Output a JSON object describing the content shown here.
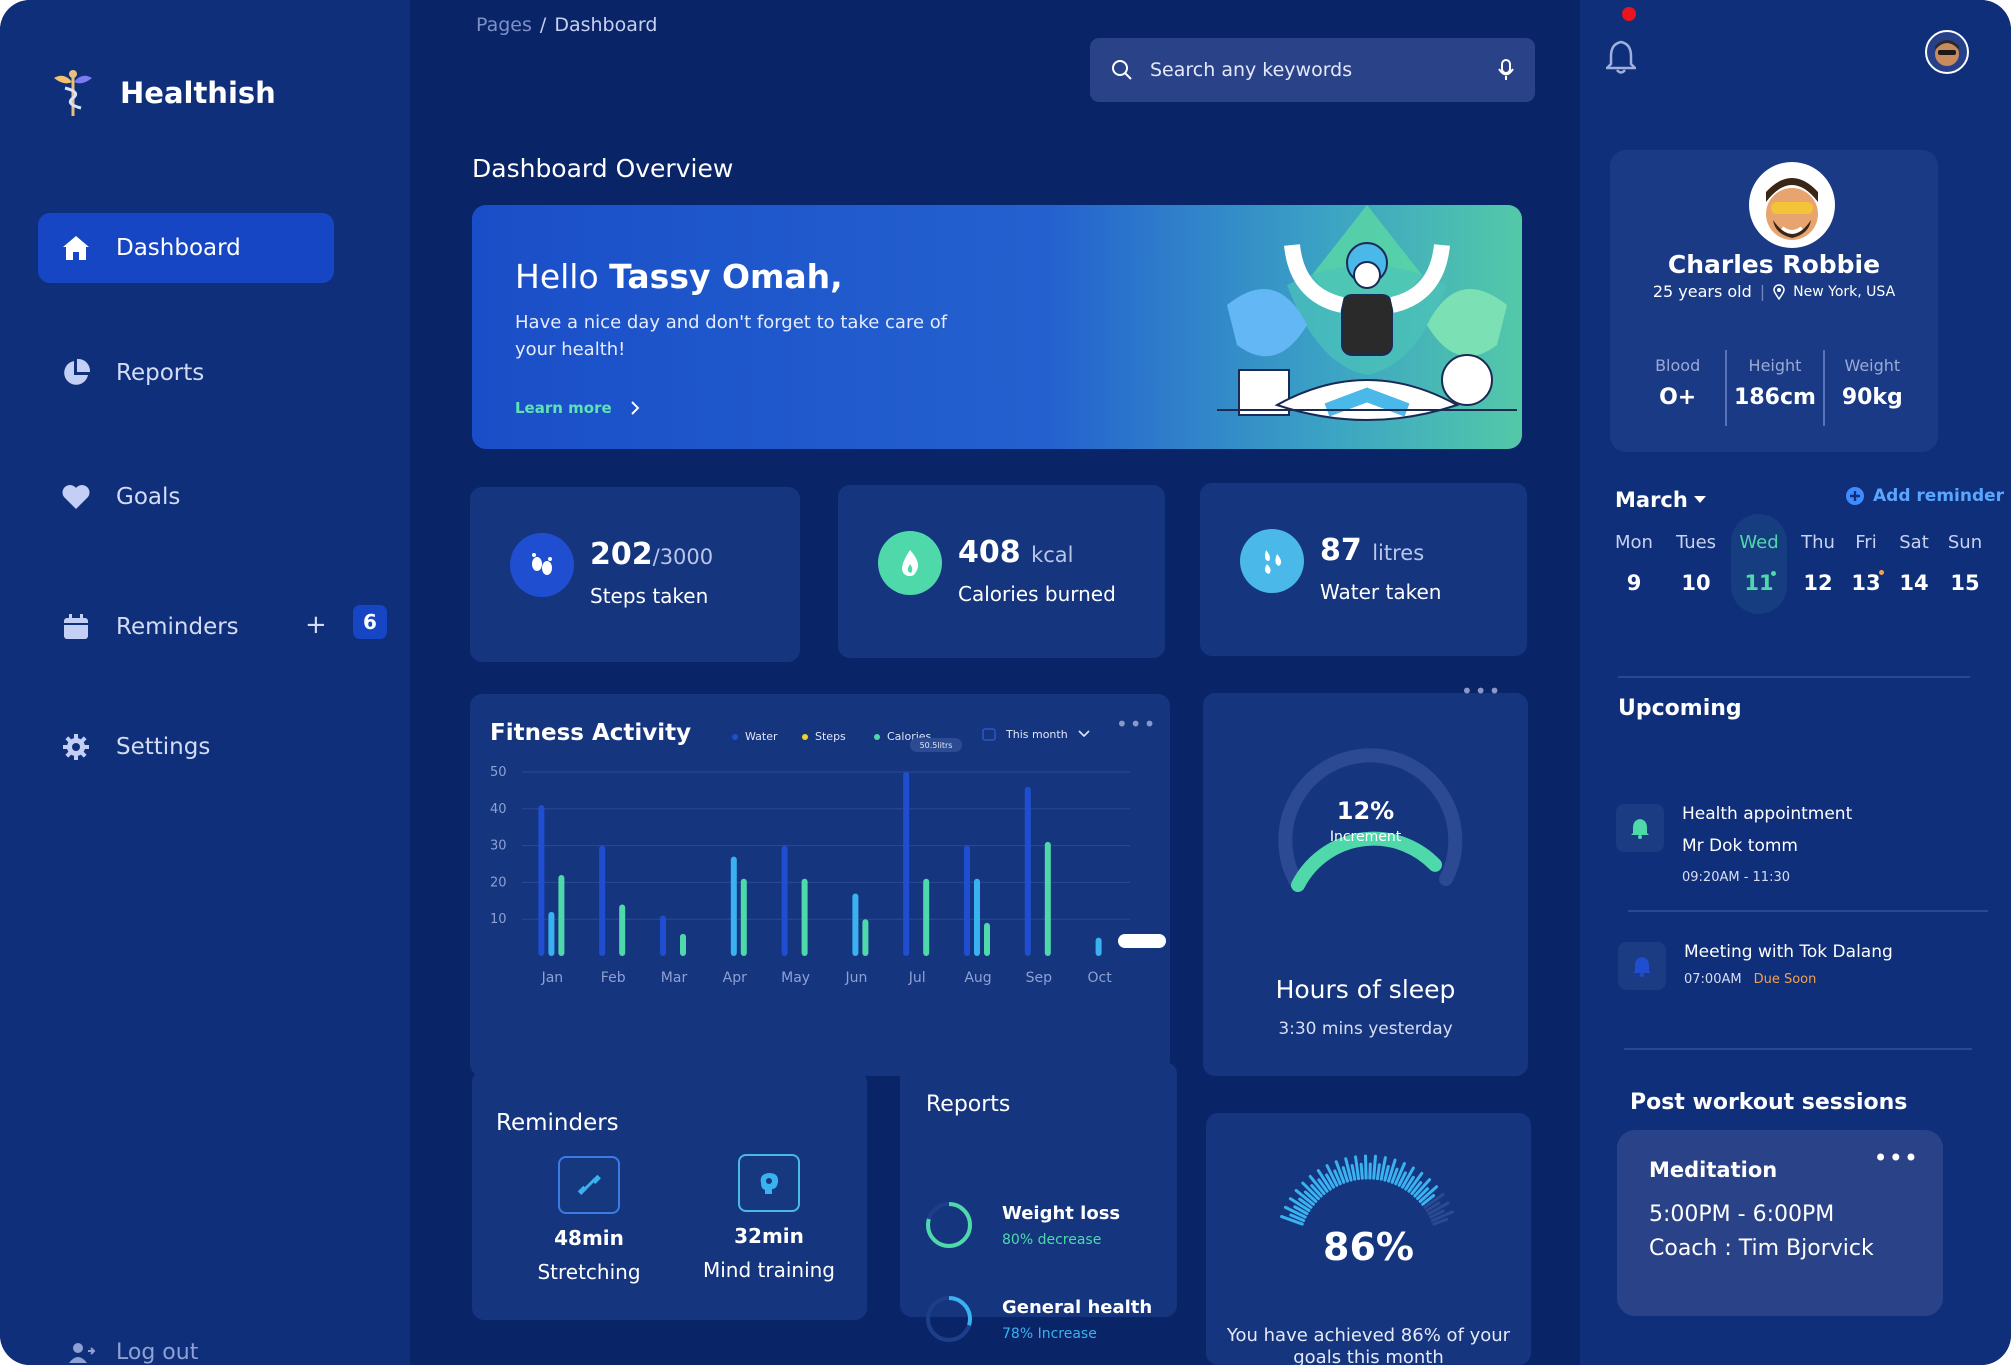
{
  "brand": {
    "name": "Healthish"
  },
  "sidebar": {
    "items": [
      {
        "label": "Dashboard",
        "icon": "home-icon"
      },
      {
        "label": "Reports",
        "icon": "pie-chart-icon"
      },
      {
        "label": "Goals",
        "icon": "heart-icon"
      },
      {
        "label": "Reminders",
        "icon": "calendar-icon"
      },
      {
        "label": "Settings",
        "icon": "gear-icon"
      }
    ],
    "reminders_add": "+",
    "reminders_badge": "6",
    "logout": "Log out"
  },
  "breadcrumb": {
    "parent": "Pages",
    "separator": "/",
    "current": "Dashboard"
  },
  "search": {
    "placeholder": "Search any keywords"
  },
  "page_title": "Dashboard Overview",
  "hero": {
    "greeting": "Hello",
    "name": "Tassy Omah,",
    "message": "Have a nice day and don't forget to take care of your health!",
    "link": "Learn more"
  },
  "stats": [
    {
      "value": "202",
      "unit": "/3000",
      "label": "Steps taken",
      "icon": "footprints-icon",
      "color": "#1f4fd0"
    },
    {
      "value": "408",
      "unit": "kcal",
      "label": "Calories burned",
      "icon": "flame-icon",
      "color": "#4fd9aa"
    },
    {
      "value": "87",
      "unit": "litres",
      "label": "Water taken",
      "icon": "water-drops-icon",
      "color": "#4ab8e8"
    }
  ],
  "fitness": {
    "title": "Fitness Activity",
    "legend": [
      "Water",
      "Steps",
      "Calories"
    ],
    "period": "This month",
    "tooltip": "50.5litrs"
  },
  "chart_data": {
    "type": "bar",
    "title": "Fitness Activity",
    "categories": [
      "Jan",
      "Feb",
      "Mar",
      "Apr",
      "May",
      "Jun",
      "Jul",
      "Aug",
      "Sep",
      "Oct"
    ],
    "yticks": [
      10,
      20,
      30,
      40,
      50
    ],
    "ylim": [
      0,
      50
    ],
    "legend_position": "top",
    "series": [
      {
        "name": "Water",
        "color": "#1f4fd0",
        "values": [
          41,
          30,
          11,
          0,
          30,
          0,
          50,
          30,
          46,
          0
        ]
      },
      {
        "name": "Steps",
        "color": "#3ab2f0",
        "values": [
          12,
          0,
          0,
          27,
          0,
          17,
          0,
          21,
          0,
          5
        ]
      },
      {
        "name": "Calories",
        "color": "#4fd9aa",
        "values": [
          22,
          14,
          6,
          21,
          21,
          10,
          21,
          9,
          31,
          0
        ]
      }
    ]
  },
  "sleep": {
    "percent": "12%",
    "percent_value": 12,
    "caption": "Increment",
    "title": "Hours of sleep",
    "subtitle": "3:30 mins yesterday"
  },
  "reminders": {
    "title": "Reminders",
    "items": [
      {
        "value": "48min",
        "label": "Stretching",
        "icon": "dumbbell-icon"
      },
      {
        "value": "32min",
        "label": "Mind training",
        "icon": "brain-icon"
      }
    ]
  },
  "reports": {
    "title": "Reports",
    "items": [
      {
        "name": "Weight loss",
        "note": "80% decrease",
        "progress": 0.8
      },
      {
        "name": "General health",
        "note": "78% Increase",
        "progress": 0.78
      }
    ]
  },
  "goals": {
    "percent": "86%",
    "progress": 0.86,
    "text": "You have achieved 86% of your goals this month"
  },
  "profile": {
    "name": "Charles Robbie",
    "age": "25 years old",
    "location": "New York, USA",
    "stats": [
      {
        "label": "Blood",
        "value": "O+"
      },
      {
        "label": "Height",
        "value": "186cm"
      },
      {
        "label": "Weight",
        "value": "90kg"
      }
    ]
  },
  "calendar": {
    "month": "March",
    "add_reminder": "Add reminder",
    "days": [
      {
        "name": "Mon",
        "date": "9"
      },
      {
        "name": "Tues",
        "date": "10"
      },
      {
        "name": "Wed",
        "date": "11"
      },
      {
        "name": "Thu",
        "date": "12"
      },
      {
        "name": "Fri",
        "date": "13"
      },
      {
        "name": "Sat",
        "date": "14"
      },
      {
        "name": "Sun",
        "date": "15"
      }
    ]
  },
  "upcoming": {
    "title": "Upcoming",
    "items": [
      {
        "title": "Health appointment",
        "subtitle": "Mr Dok tomm",
        "time": "09:20AM - 11:30"
      },
      {
        "title": "Meeting with Tok Dalang",
        "time": "07:00AM",
        "status": "Due Soon"
      }
    ]
  },
  "post_workout": {
    "title": "Post workout sessions",
    "session": {
      "name": "Meditation",
      "time": "5:00PM - 6:00PM",
      "coach": "Coach : Tim Bjorvick"
    }
  },
  "colors": {
    "bg": "#0a2468",
    "panel": "#15357f",
    "accent": "#1746c4",
    "green": "#4fd9aa",
    "blue": "#3ab2f0"
  }
}
